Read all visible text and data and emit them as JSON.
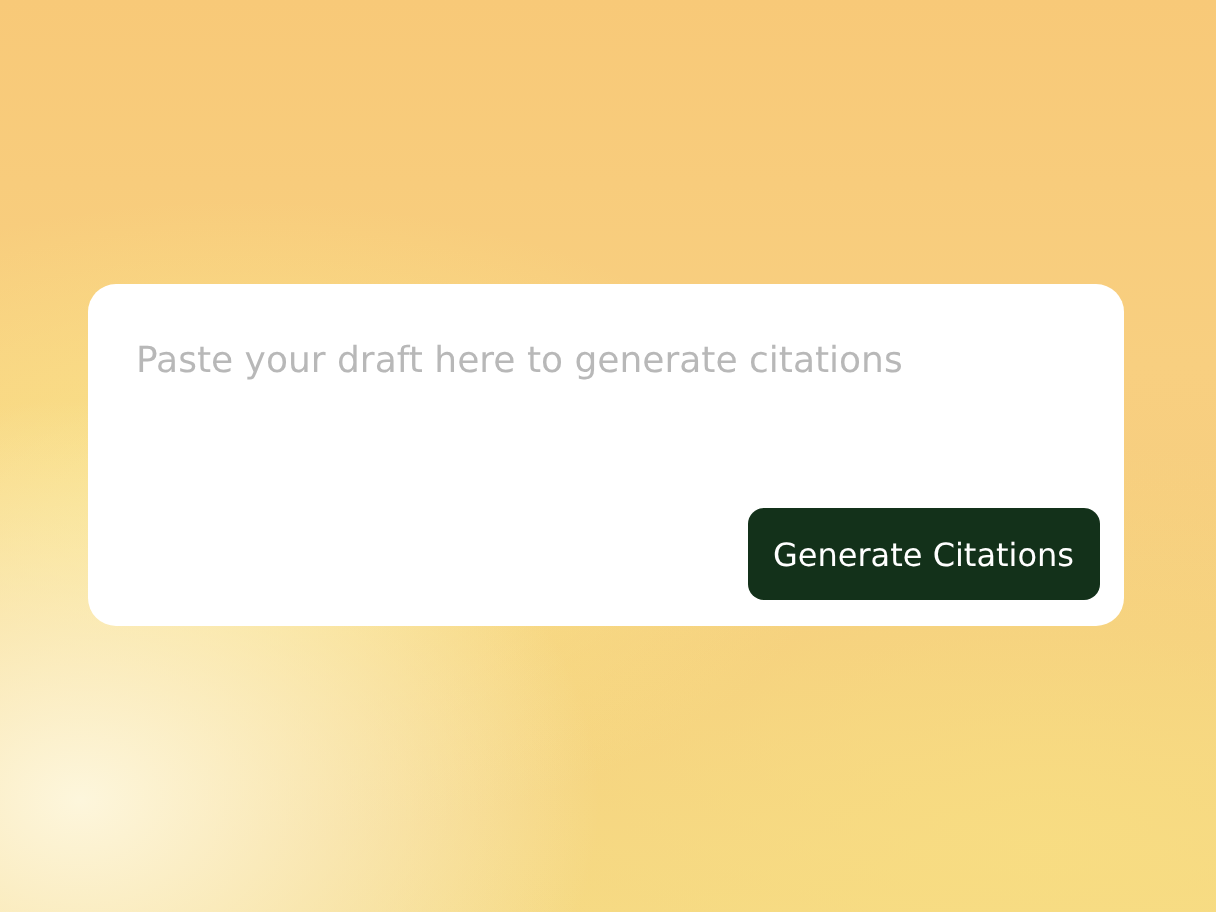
{
  "draft_field": {
    "placeholder": "Paste your draft here to generate citations"
  },
  "button": {
    "label": "Generate Citations"
  }
}
